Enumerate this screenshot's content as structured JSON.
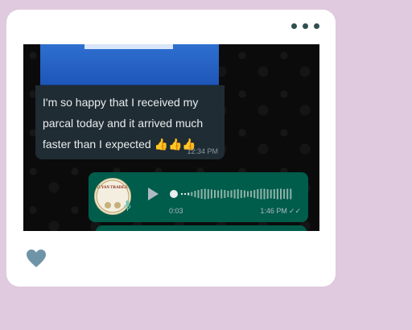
{
  "incoming_message": {
    "text": "I'm so happy that I received my parcal today and it arrived much faster than I expected 👍👍👍",
    "time": "12:34 PM"
  },
  "voice_message": {
    "avatar_text": "AYYAN TRADERS",
    "duration": "0:03",
    "time": "1:46 PM",
    "ticks": "✓✓"
  },
  "colors": {
    "page_background": "#dfcadf",
    "incoming_bubble": "#202c33",
    "outgoing_bubble": "#005c4b",
    "heart": "#6f94a8"
  },
  "icons": {
    "menu": "more-dots-icon",
    "play": "play-icon",
    "mic": "mic-icon",
    "like": "heart-icon"
  }
}
